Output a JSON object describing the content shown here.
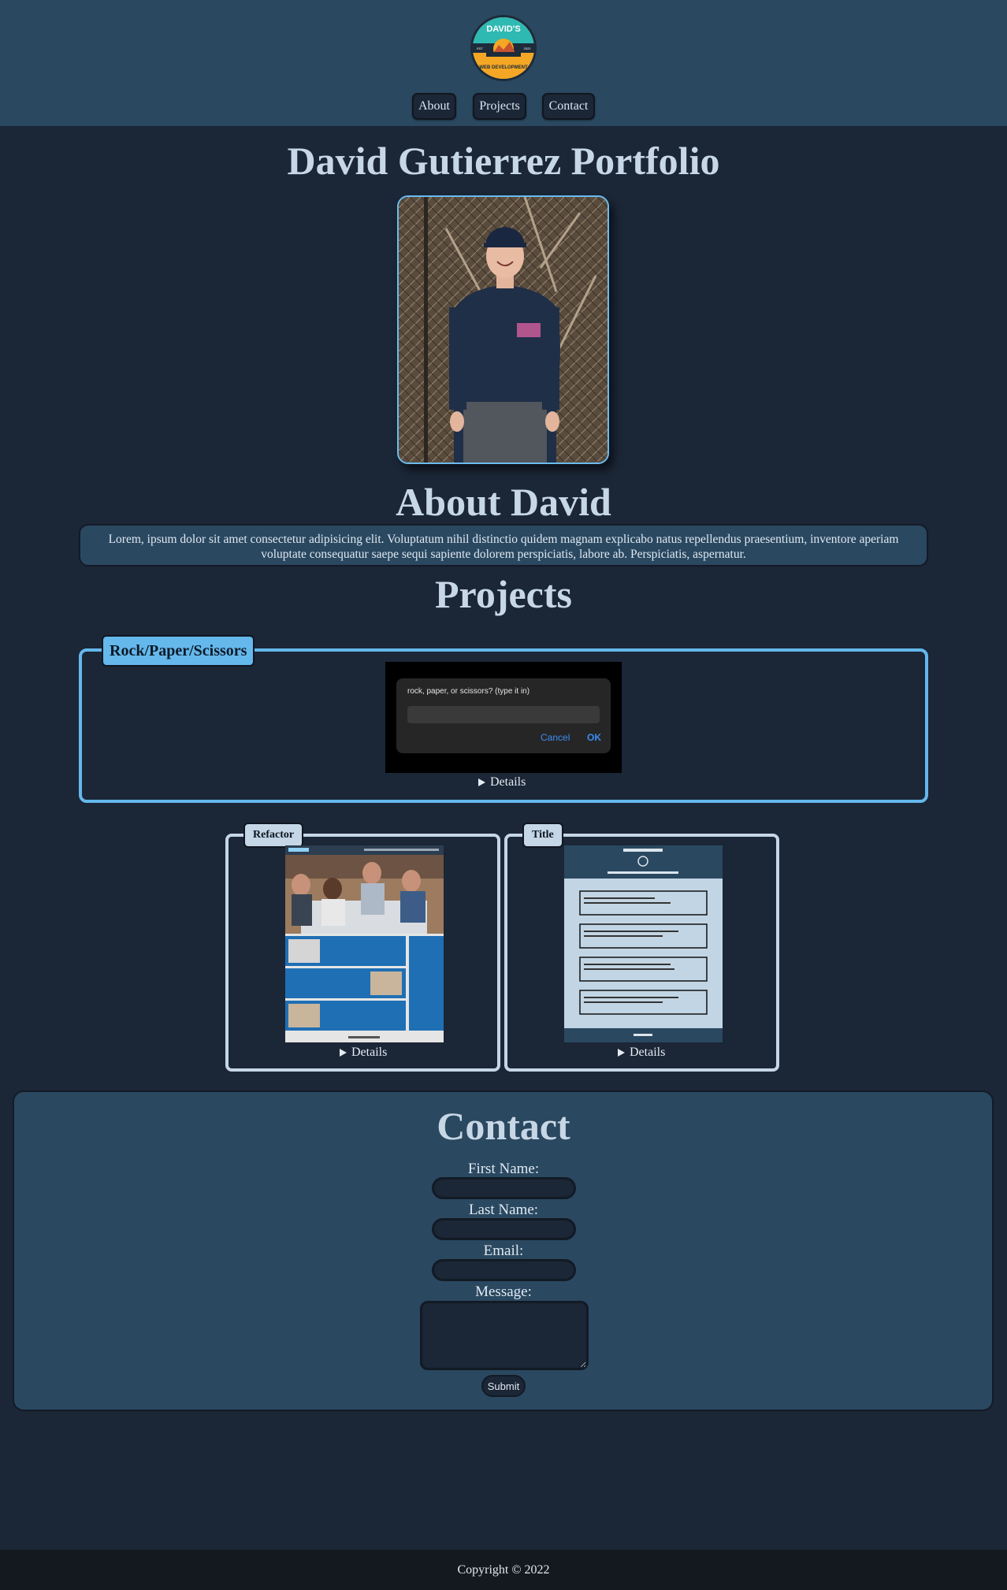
{
  "header": {
    "logo": {
      "top_text": "DAVID'S",
      "bottom_text": "WEB DEVELOPMENT",
      "left_text": "EST",
      "right_text": "2022"
    },
    "nav": [
      {
        "label": "About"
      },
      {
        "label": "Projects"
      },
      {
        "label": "Contact"
      }
    ]
  },
  "page_title": "David Gutierrez Portfolio",
  "about": {
    "title": "About David",
    "text": "Lorem, ipsum dolor sit amet consectetur adipisicing elit. Voluptatum nihil distinctio quidem magnam explicabo natus repellendus praesentium, inventore aperiam voluptate consequatur saepe sequi sapiente dolorem perspiciatis, labore ab. Perspiciatis, aspernatur."
  },
  "projects": {
    "title": "Projects",
    "items": [
      {
        "legend": "Rock/Paper/Scissors",
        "details_label": "Details",
        "preview": {
          "prompt": "rock, paper, or scissors? (type it in)",
          "cancel": "Cancel",
          "ok": "OK"
        }
      },
      {
        "legend": "Refactor",
        "details_label": "Details"
      },
      {
        "legend": "Title",
        "details_label": "Details"
      }
    ]
  },
  "contact": {
    "title": "Contact",
    "fields": [
      {
        "label": "First Name:"
      },
      {
        "label": "Last Name:"
      },
      {
        "label": "Email:"
      },
      {
        "label": "Message:"
      }
    ],
    "submit_label": "Submit"
  },
  "footer": {
    "copyright": "Copyright © 2022"
  },
  "colors": {
    "background": "#1b2636",
    "panel": "#2a4860",
    "accent": "#64b8ec",
    "light_border": "#c5d6e6",
    "footer": "#14191f"
  }
}
